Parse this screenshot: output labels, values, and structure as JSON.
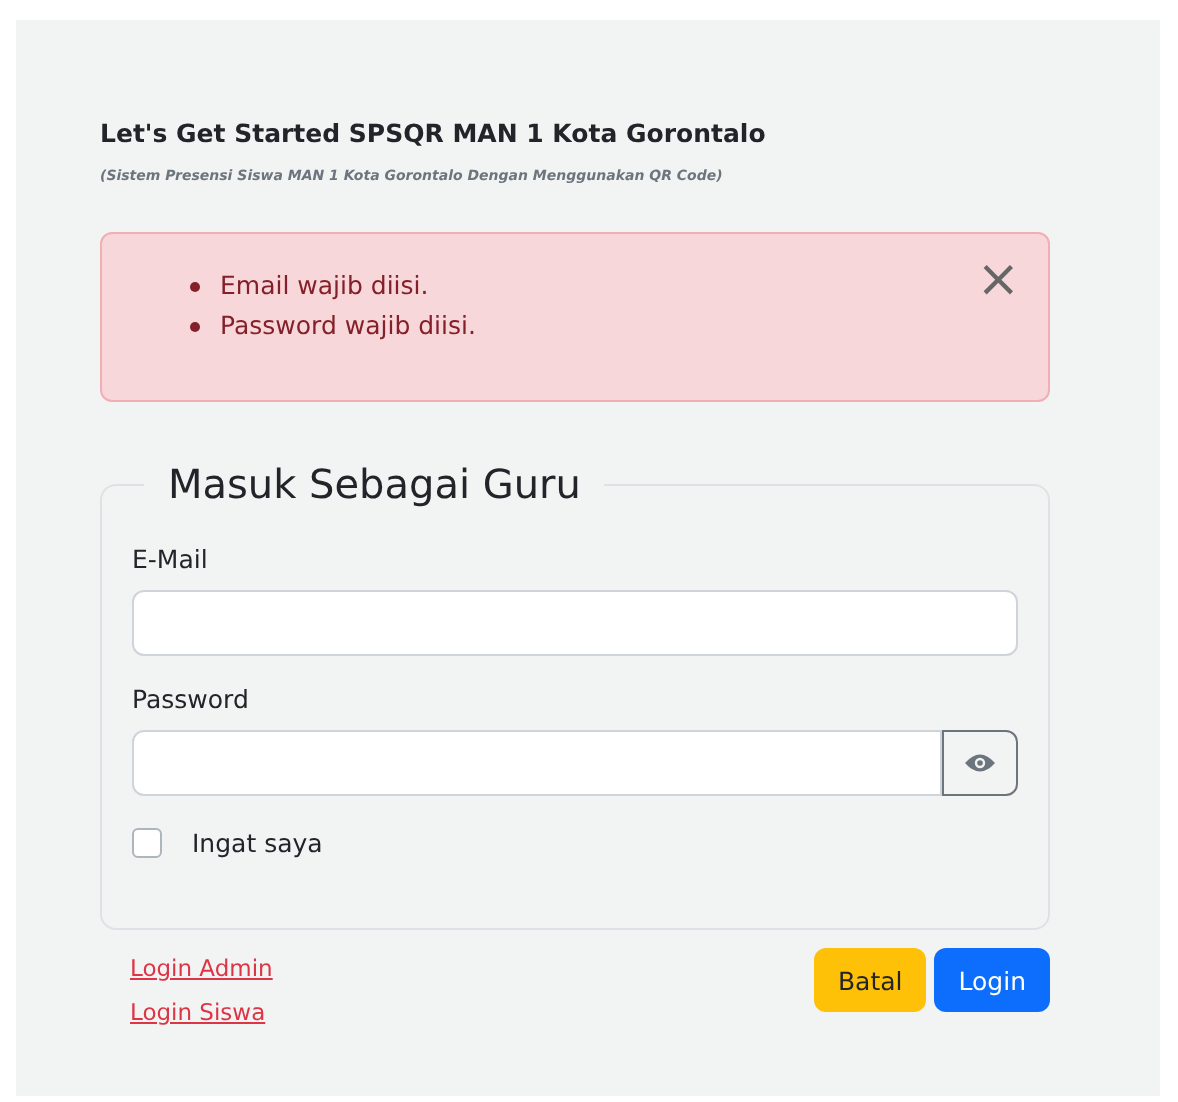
{
  "header": {
    "title": "Let's Get Started SPSQR MAN 1 Kota Gorontalo",
    "subtitle": "(Sistem Presensi Siswa MAN 1 Kota Gorontalo Dengan Menggunakan QR Code)"
  },
  "alert": {
    "close": "×",
    "messages": [
      "Email wajib diisi.",
      "Password wajib diisi."
    ]
  },
  "form": {
    "legend": "Masuk Sebagai Guru",
    "fields": [
      {
        "label": "E-Mail",
        "kind": "text"
      },
      {
        "label": "Password",
        "kind": "password"
      }
    ],
    "remember": {
      "label": "Ingat saya",
      "checked": false
    }
  },
  "links": [
    "Login Admin",
    "Login Siswa"
  ],
  "buttons": [
    {
      "label": "Batal",
      "kind": "warning"
    },
    {
      "label": "Login",
      "kind": "primary"
    }
  ]
}
